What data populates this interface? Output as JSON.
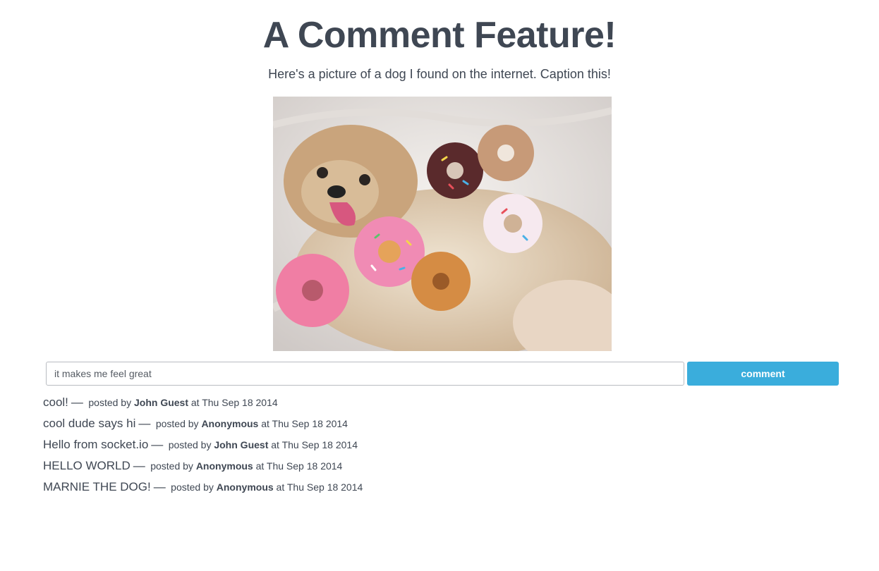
{
  "header": {
    "title": "A Comment Feature!",
    "subtitle": "Here's a picture of a dog I found on the internet. Caption this!"
  },
  "form": {
    "input_value": "it makes me feel great",
    "button_label": "comment"
  },
  "comments": [
    {
      "text": "cool!",
      "dash": "—",
      "posted_by": "posted by",
      "author": "John Guest",
      "at": "at",
      "date": "Thu Sep 18 2014"
    },
    {
      "text": "cool dude says hi",
      "dash": "—",
      "posted_by": "posted by",
      "author": "Anonymous",
      "at": "at",
      "date": "Thu Sep 18 2014"
    },
    {
      "text": "Hello from socket.io",
      "dash": "—",
      "posted_by": "posted by",
      "author": "John Guest",
      "at": "at",
      "date": "Thu Sep 18 2014"
    },
    {
      "text": "HELLO WORLD",
      "dash": "—",
      "posted_by": "posted by",
      "author": "Anonymous",
      "at": "at",
      "date": "Thu Sep 18 2014"
    },
    {
      "text": "MARNIE THE DOG!",
      "dash": "—",
      "posted_by": "posted by",
      "author": "Anonymous",
      "at": "at",
      "date": "Thu Sep 18 2014"
    }
  ],
  "colors": {
    "text": "#3f4753",
    "button": "#3aaddc",
    "input_border": "#b9bcc1"
  }
}
